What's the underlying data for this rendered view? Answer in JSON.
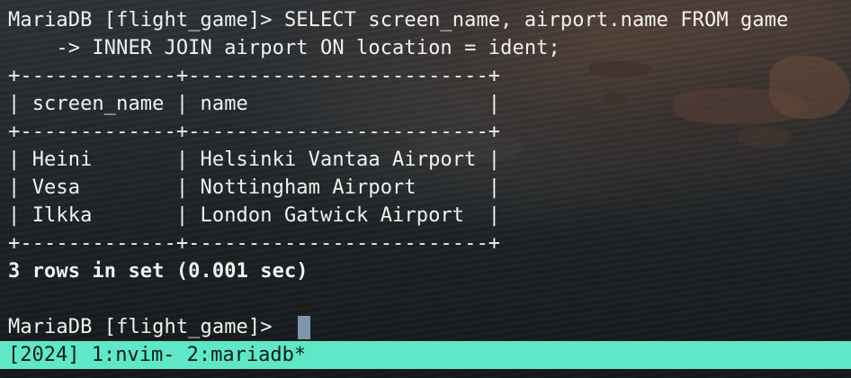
{
  "terminal": {
    "lines": [
      "MariaDB [flight_game]> SELECT screen_name, airport.name FROM game",
      "    -> INNER JOIN airport ON location = ident;",
      "+-------------+-------------------------+",
      "| screen_name | name                    |",
      "+-------------+-------------------------+",
      "| Heini       | Helsinki Vantaa Airport |",
      "| Vesa        | Nottingham Airport      |",
      "| Ilkka       | London Gatwick Airport  |",
      "+-------------+-------------------------+",
      "3 rows in set (0.001 sec)",
      "",
      "MariaDB [flight_game]> "
    ]
  },
  "status_bar": {
    "text": "[2024] 1:nvim- 2:mariadb*",
    "background": "#5ee8c8"
  },
  "colors": {
    "text": "#f1f1ef",
    "cursor": "#7f96aa"
  }
}
